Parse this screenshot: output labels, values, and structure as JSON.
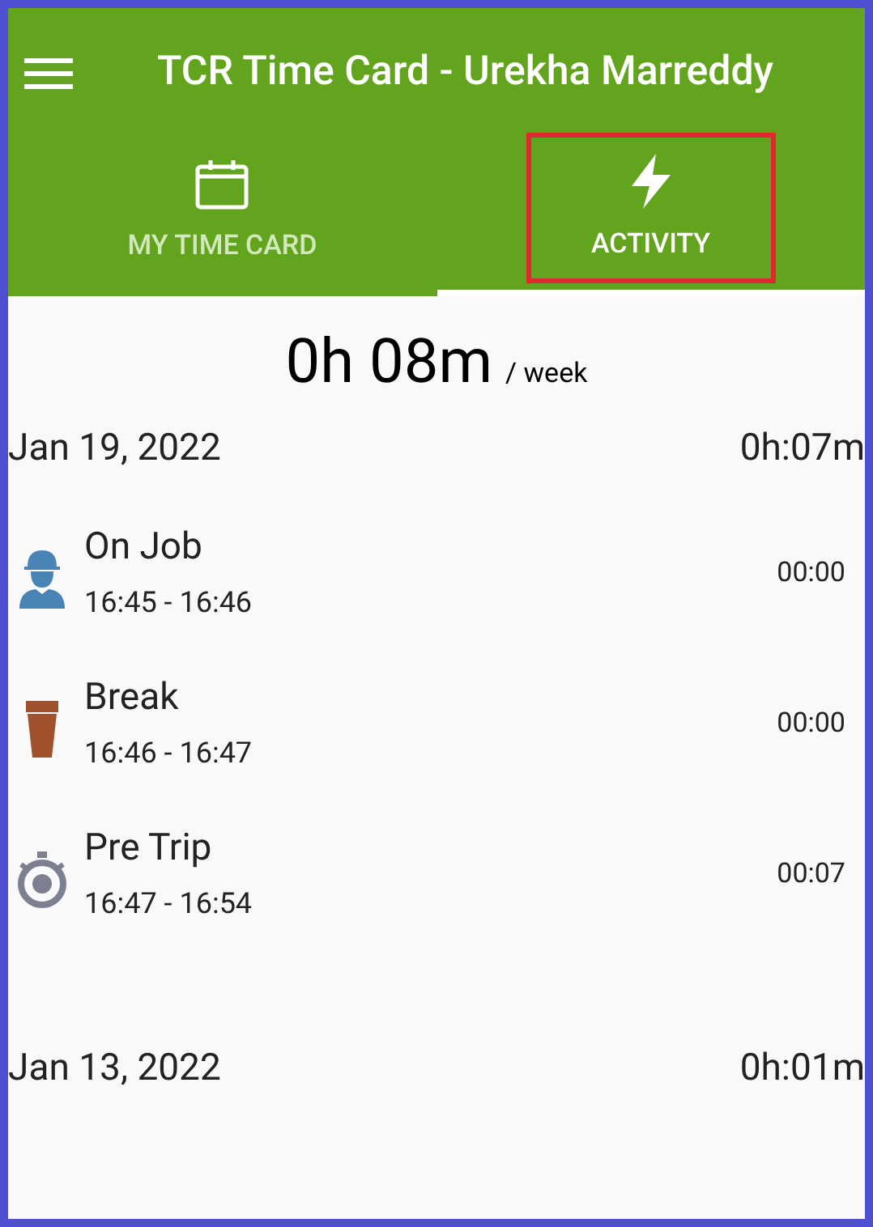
{
  "app_bar": {
    "title": "TCR Time Card - Urekha Marreddy"
  },
  "tabs": [
    {
      "label": "MY TIME CARD",
      "kind": "calendar",
      "selected": false,
      "highlighted": false
    },
    {
      "label": "ACTIVITY",
      "kind": "bolt",
      "selected": true,
      "highlighted": true
    }
  ],
  "total": {
    "value": "0h 08m",
    "unit": "/ week"
  },
  "days": [
    {
      "date": "Jan 19, 2022",
      "total": "0h:07m",
      "entries": [
        {
          "kind": "on_job",
          "name": "On Job",
          "range": "16:45 - 16:46",
          "duration": "00:00"
        },
        {
          "kind": "break",
          "name": "Break",
          "range": "16:46 - 16:47",
          "duration": "00:00"
        },
        {
          "kind": "pre_trip",
          "name": "Pre Trip",
          "range": "16:47 - 16:54",
          "duration": "00:07"
        }
      ]
    },
    {
      "date": "Jan 13, 2022",
      "total": "0h:01m"
    }
  ]
}
